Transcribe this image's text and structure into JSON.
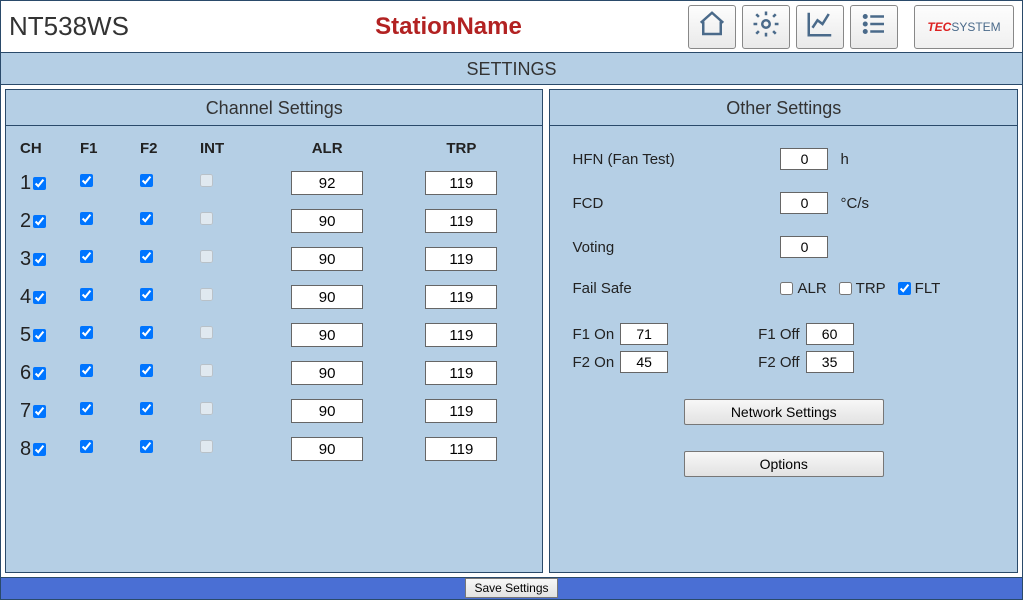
{
  "header": {
    "device_name": "NT538WS",
    "station_name": "StationName",
    "logo_tec": "TEC",
    "logo_sys": "SYSTEM"
  },
  "title": "SETTINGS",
  "panels": {
    "channel_title": "Channel Settings",
    "other_title": "Other Settings"
  },
  "ch_headers": {
    "ch": "CH",
    "f1": "F1",
    "f2": "F2",
    "int": "INT",
    "alr": "ALR",
    "trp": "TRP"
  },
  "channels": [
    {
      "n": "1",
      "en": true,
      "f1": true,
      "f2": true,
      "int": false,
      "alr": "92",
      "trp": "119"
    },
    {
      "n": "2",
      "en": true,
      "f1": true,
      "f2": true,
      "int": false,
      "alr": "90",
      "trp": "119"
    },
    {
      "n": "3",
      "en": true,
      "f1": true,
      "f2": true,
      "int": false,
      "alr": "90",
      "trp": "119"
    },
    {
      "n": "4",
      "en": true,
      "f1": true,
      "f2": true,
      "int": false,
      "alr": "90",
      "trp": "119"
    },
    {
      "n": "5",
      "en": true,
      "f1": true,
      "f2": true,
      "int": false,
      "alr": "90",
      "trp": "119"
    },
    {
      "n": "6",
      "en": true,
      "f1": true,
      "f2": true,
      "int": false,
      "alr": "90",
      "trp": "119"
    },
    {
      "n": "7",
      "en": true,
      "f1": true,
      "f2": true,
      "int": false,
      "alr": "90",
      "trp": "119"
    },
    {
      "n": "8",
      "en": true,
      "f1": true,
      "f2": true,
      "int": false,
      "alr": "90",
      "trp": "119"
    }
  ],
  "other": {
    "hfn_label": "HFN (Fan Test)",
    "hfn_value": "0",
    "hfn_unit": "h",
    "fcd_label": "FCD",
    "fcd_value": "0",
    "fcd_unit": "°C/s",
    "voting_label": "Voting",
    "voting_value": "0",
    "failsafe_label": "Fail Safe",
    "fs_alr": "ALR",
    "fs_trp": "TRP",
    "fs_flt": "FLT",
    "fs_alr_checked": false,
    "fs_trp_checked": false,
    "fs_flt_checked": true,
    "f1on_label": "F1 On",
    "f1on_value": "71",
    "f1off_label": "F1 Off",
    "f1off_value": "60",
    "f2on_label": "F2 On",
    "f2on_value": "45",
    "f2off_label": "F2 Off",
    "f2off_value": "35",
    "network_btn": "Network Settings",
    "options_btn": "Options"
  },
  "footer": {
    "save": "Save Settings"
  }
}
